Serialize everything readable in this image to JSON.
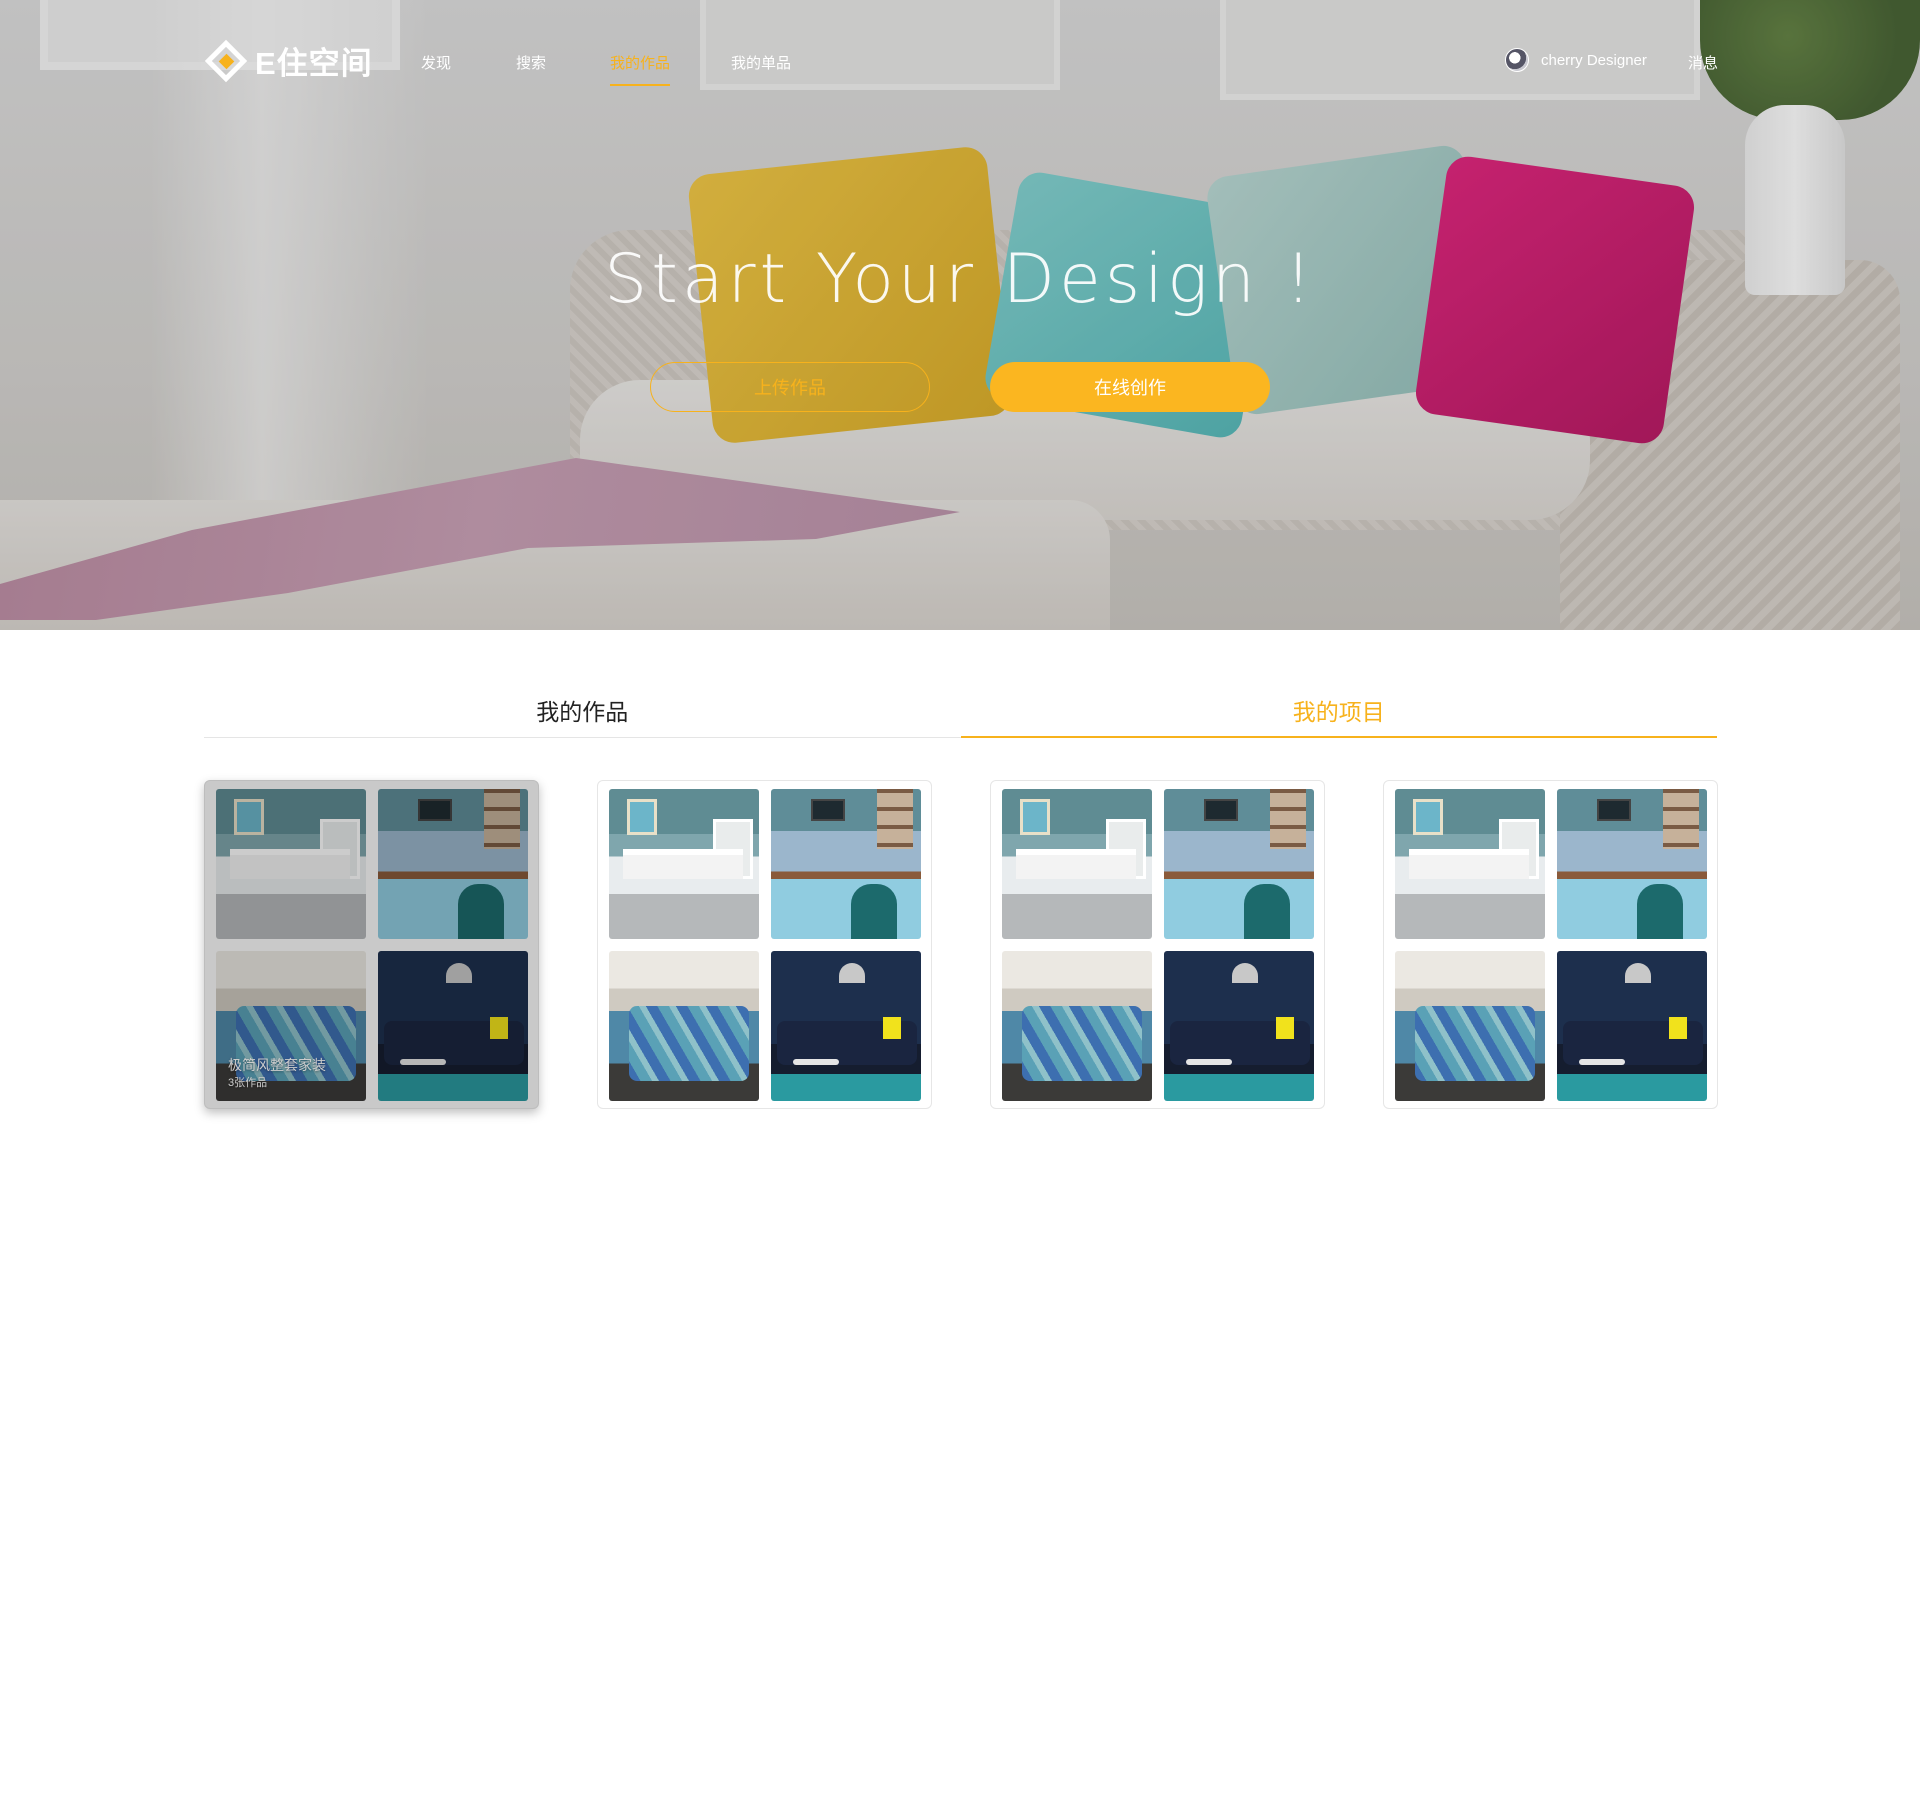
{
  "brand": {
    "name": "E住空间",
    "accent": "#f7b21c"
  },
  "nav": {
    "items": [
      {
        "label": "发现",
        "active": false
      },
      {
        "label": "搜索",
        "active": false
      },
      {
        "label": "我的作品",
        "active": true
      },
      {
        "label": "我的单品",
        "active": false
      }
    ],
    "user_name": "cherry Designer",
    "messages_label": "消息"
  },
  "hero": {
    "headline": "Start Your Design !",
    "upload_button": "上传作品",
    "create_button": "在线创作"
  },
  "tabs": [
    {
      "label": "我的作品",
      "active": false
    },
    {
      "label": "我的项目",
      "active": true
    }
  ],
  "cards": [
    {
      "title": "极简风整套家装",
      "count_label": "3张作品",
      "hovered": true
    },
    {
      "title": "",
      "count_label": "",
      "hovered": false
    },
    {
      "title": "",
      "count_label": "",
      "hovered": false
    },
    {
      "title": "",
      "count_label": "",
      "hovered": false
    }
  ],
  "icons": {
    "logo": "diamond-logo-icon",
    "avatar": "user-avatar"
  }
}
